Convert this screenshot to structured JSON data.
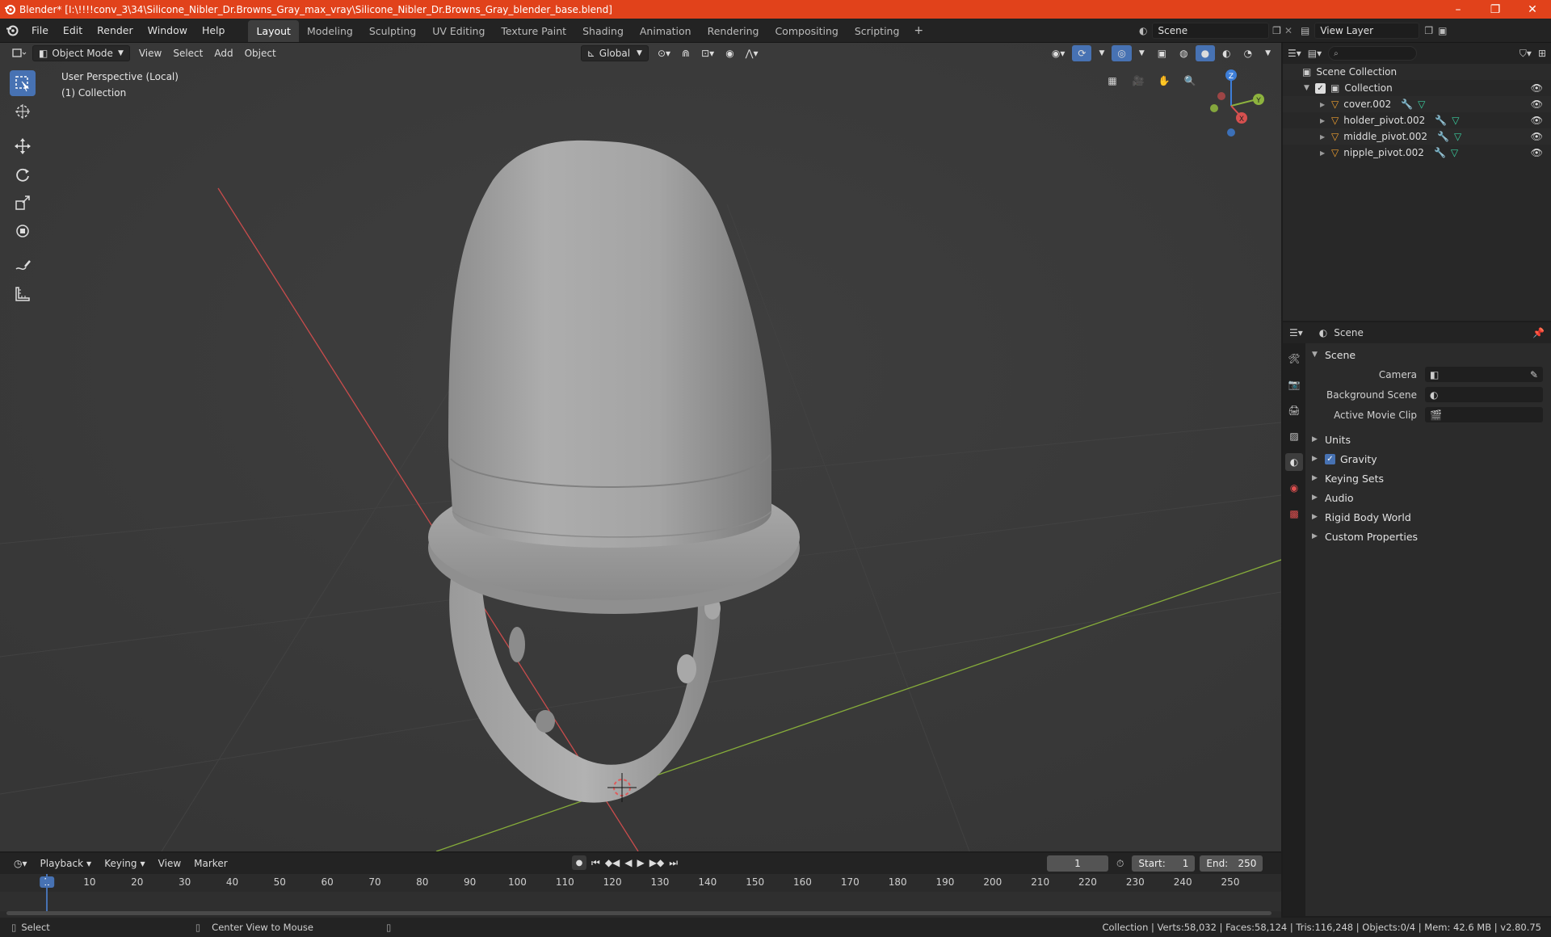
{
  "titlebar": {
    "title": "Blender* [I:\\!!!!conv_3\\34\\Silicone_Nibler_Dr.Browns_Gray_max_vray\\Silicone_Nibler_Dr.Browns_Gray_blender_base.blend]",
    "minimize": "–",
    "maximize": "❐",
    "close": "✕"
  },
  "menubar": {
    "menus": [
      "File",
      "Edit",
      "Render",
      "Window",
      "Help"
    ],
    "workspaces": [
      "Layout",
      "Modeling",
      "Sculpting",
      "UV Editing",
      "Texture Paint",
      "Shading",
      "Animation",
      "Rendering",
      "Compositing",
      "Scripting"
    ],
    "active_workspace": "Layout",
    "add_workspace": "+",
    "scene": "Scene",
    "view_layer": "View Layer"
  },
  "viewport": {
    "mode": "Object Mode",
    "menus": [
      "View",
      "Select",
      "Add",
      "Object"
    ],
    "transform_orientation": "Global",
    "info_line1": "User Perspective (Local)",
    "info_line2": "(1) Collection",
    "gizmo": {
      "x": "X",
      "y": "Y",
      "z": "Z"
    }
  },
  "outliner": {
    "root": "Scene Collection",
    "collection": "Collection",
    "objects": [
      "cover.002",
      "holder_pivot.002",
      "middle_pivot.002",
      "nipple_pivot.002"
    ]
  },
  "properties": {
    "context": "Scene",
    "panel_title": "Scene",
    "fields": [
      {
        "label": "Camera"
      },
      {
        "label": "Background Scene"
      },
      {
        "label": "Active Movie Clip"
      }
    ],
    "subpanels": [
      "Units",
      "Gravity",
      "Keying Sets",
      "Audio",
      "Rigid Body World",
      "Custom Properties"
    ]
  },
  "timeline": {
    "menus": [
      "Playback",
      "Keying",
      "View",
      "Marker"
    ],
    "current_frame": "1",
    "start_label": "Start:",
    "start": "1",
    "end_label": "End:",
    "end": "250",
    "ruler_marks": [
      "1",
      "10",
      "20",
      "30",
      "40",
      "50",
      "60",
      "70",
      "80",
      "90",
      "100",
      "110",
      "120",
      "130",
      "140",
      "150",
      "160",
      "170",
      "180",
      "190",
      "200",
      "210",
      "220",
      "230",
      "240",
      "250"
    ]
  },
  "statusbar": {
    "left_action": "Select",
    "mid_action": "Center View to Mouse",
    "stats": "Collection | Verts:58,032 | Faces:58,124 | Tris:116,248 | Objects:0/4 | Mem: 42.6 MB | v2.80.75"
  },
  "colors": {
    "titlebar": "#e1421b",
    "accent": "#4772b3",
    "viewport_bg": "#393939",
    "axis_x": "#d6504f",
    "axis_y": "#8db33e",
    "axis_z": "#3d7ed8",
    "object_icon": "#f0a030"
  }
}
